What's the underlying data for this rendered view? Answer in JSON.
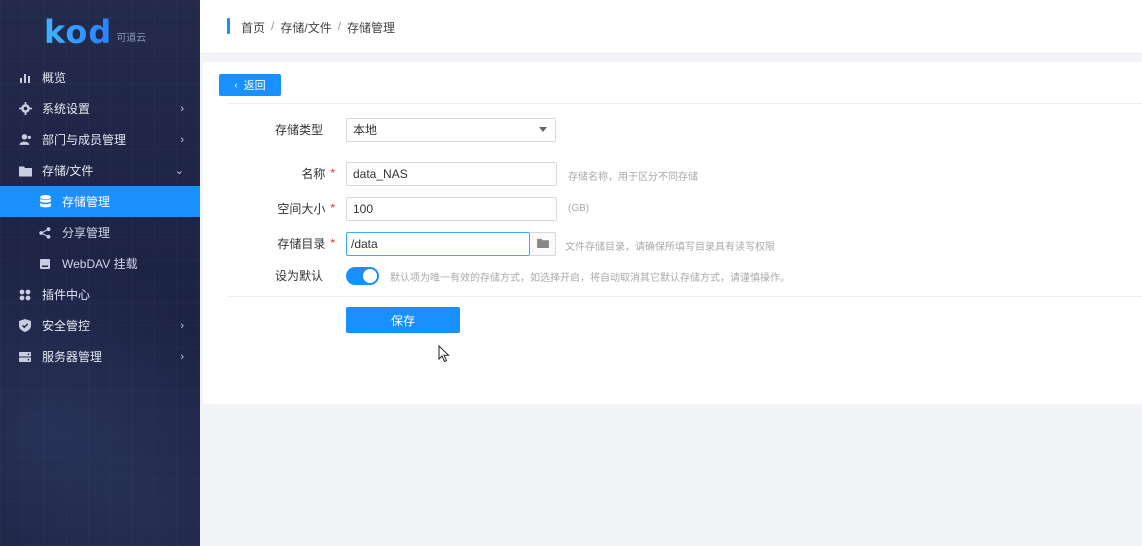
{
  "logo": {
    "word": "kod",
    "sub": "可道云"
  },
  "sidebar": {
    "items": [
      {
        "label": "概览",
        "icon": "bar-chart-icon"
      },
      {
        "label": "系统设置",
        "icon": "gear-icon",
        "has_children": true
      },
      {
        "label": "部门与成员管理",
        "icon": "users-icon",
        "has_children": true
      },
      {
        "label": "存储/文件",
        "icon": "folder-icon",
        "expanded": true,
        "children": [
          {
            "label": "存储管理",
            "icon": "database-icon",
            "active": true
          },
          {
            "label": "分享管理",
            "icon": "share-icon"
          },
          {
            "label": "WebDAV 挂载",
            "icon": "drive-icon"
          }
        ]
      },
      {
        "label": "插件中心",
        "icon": "apps-icon"
      },
      {
        "label": "安全管控",
        "icon": "shield-icon",
        "has_children": true
      },
      {
        "label": "服务器管理",
        "icon": "server-icon",
        "has_children": true
      }
    ]
  },
  "breadcrumb": {
    "home": "首页",
    "section": "存储/文件",
    "current": "存储管理",
    "separator": "/"
  },
  "form": {
    "back_label": "返回",
    "storage_type": {
      "label": "存储类型",
      "value": "本地"
    },
    "name": {
      "label": "名称",
      "value": "data_NAS",
      "hint": "存储名称，用于区分不同存储"
    },
    "size": {
      "label": "空间大小",
      "value": "100",
      "hint": "(GB)"
    },
    "directory": {
      "label": "存储目录",
      "value": "/data",
      "hint": "文件存储目录，请确保所填写目录具有读写权限"
    },
    "default": {
      "label": "设为默认",
      "enabled": true,
      "hint": "默认项为唯一有效的存储方式，如选择开启，将自动取消其它默认存储方式，请谨慎操作。"
    },
    "required_mark": "*",
    "save_label": "保存"
  },
  "colors": {
    "accent": "#1890ff",
    "sidebar_bg": "#1d2445",
    "required": "#f5222d"
  }
}
